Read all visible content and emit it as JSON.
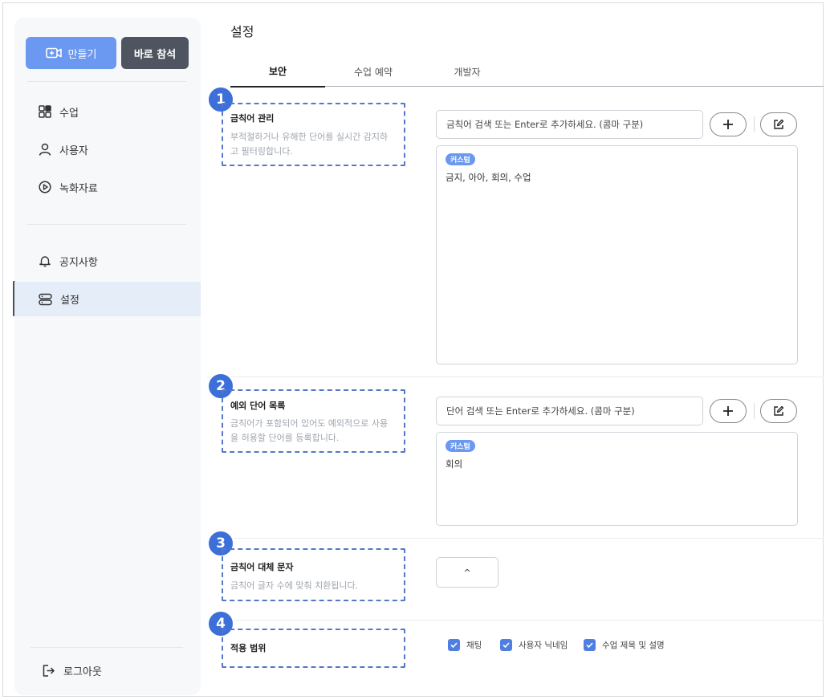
{
  "sidebar": {
    "create_label": "만들기",
    "attend_label": "바로 참석",
    "items": [
      {
        "label": "수업",
        "icon": "grid-icon"
      },
      {
        "label": "사용자",
        "icon": "user-icon"
      },
      {
        "label": "녹화자료",
        "icon": "play-circle-icon"
      },
      {
        "label": "공지사항",
        "icon": "bell-icon"
      },
      {
        "label": "설정",
        "icon": "server-icon"
      }
    ],
    "active_item": "설정",
    "logout_label": "로그아웃"
  },
  "page": {
    "title": "설정",
    "tabs": [
      {
        "label": "보안",
        "active": true
      },
      {
        "label": "수업 예약",
        "active": false
      },
      {
        "label": "개발자",
        "active": false
      }
    ]
  },
  "sections": {
    "forbidden": {
      "number": "1",
      "title": "금칙어 관리",
      "desc_line1": "부적절하거나 유해한 단어를 실시간 감지하",
      "desc_line2": "고 필터링합니다.",
      "placeholder": "금칙어 검색 또는 Enter로 추가하세요. (콤마 구분)",
      "badge": "커스텀",
      "words": "금지, 아아, 회의, 수업"
    },
    "exception": {
      "number": "2",
      "title": "예외 단어 목록",
      "desc_line1": "금칙어가 포함되어 있어도 예외적으로 사용",
      "desc_line2": "을 허용할 단어를 등록합니다.",
      "placeholder": "단어 검색 또는 Enter로 추가하세요. (콤마 구분)",
      "badge": "커스텀",
      "words": "회의"
    },
    "replacement": {
      "number": "3",
      "title": "금칙어 대체 문자",
      "desc": "금칙어 글자 수에 맞춰 치환됩니다.",
      "value": "^"
    },
    "scope": {
      "number": "4",
      "title": "적용 범위",
      "options": [
        {
          "label": "채팅",
          "checked": true
        },
        {
          "label": "사용자 닉네임",
          "checked": true
        },
        {
          "label": "수업 제목 및 설명",
          "checked": true
        }
      ]
    }
  },
  "colors": {
    "accent": "#6b98f0",
    "dark_button": "#4f5560",
    "number_badge": "#3d6fd9",
    "dashed_outline": "#5577c8",
    "checkbox": "#4f7fe0"
  }
}
